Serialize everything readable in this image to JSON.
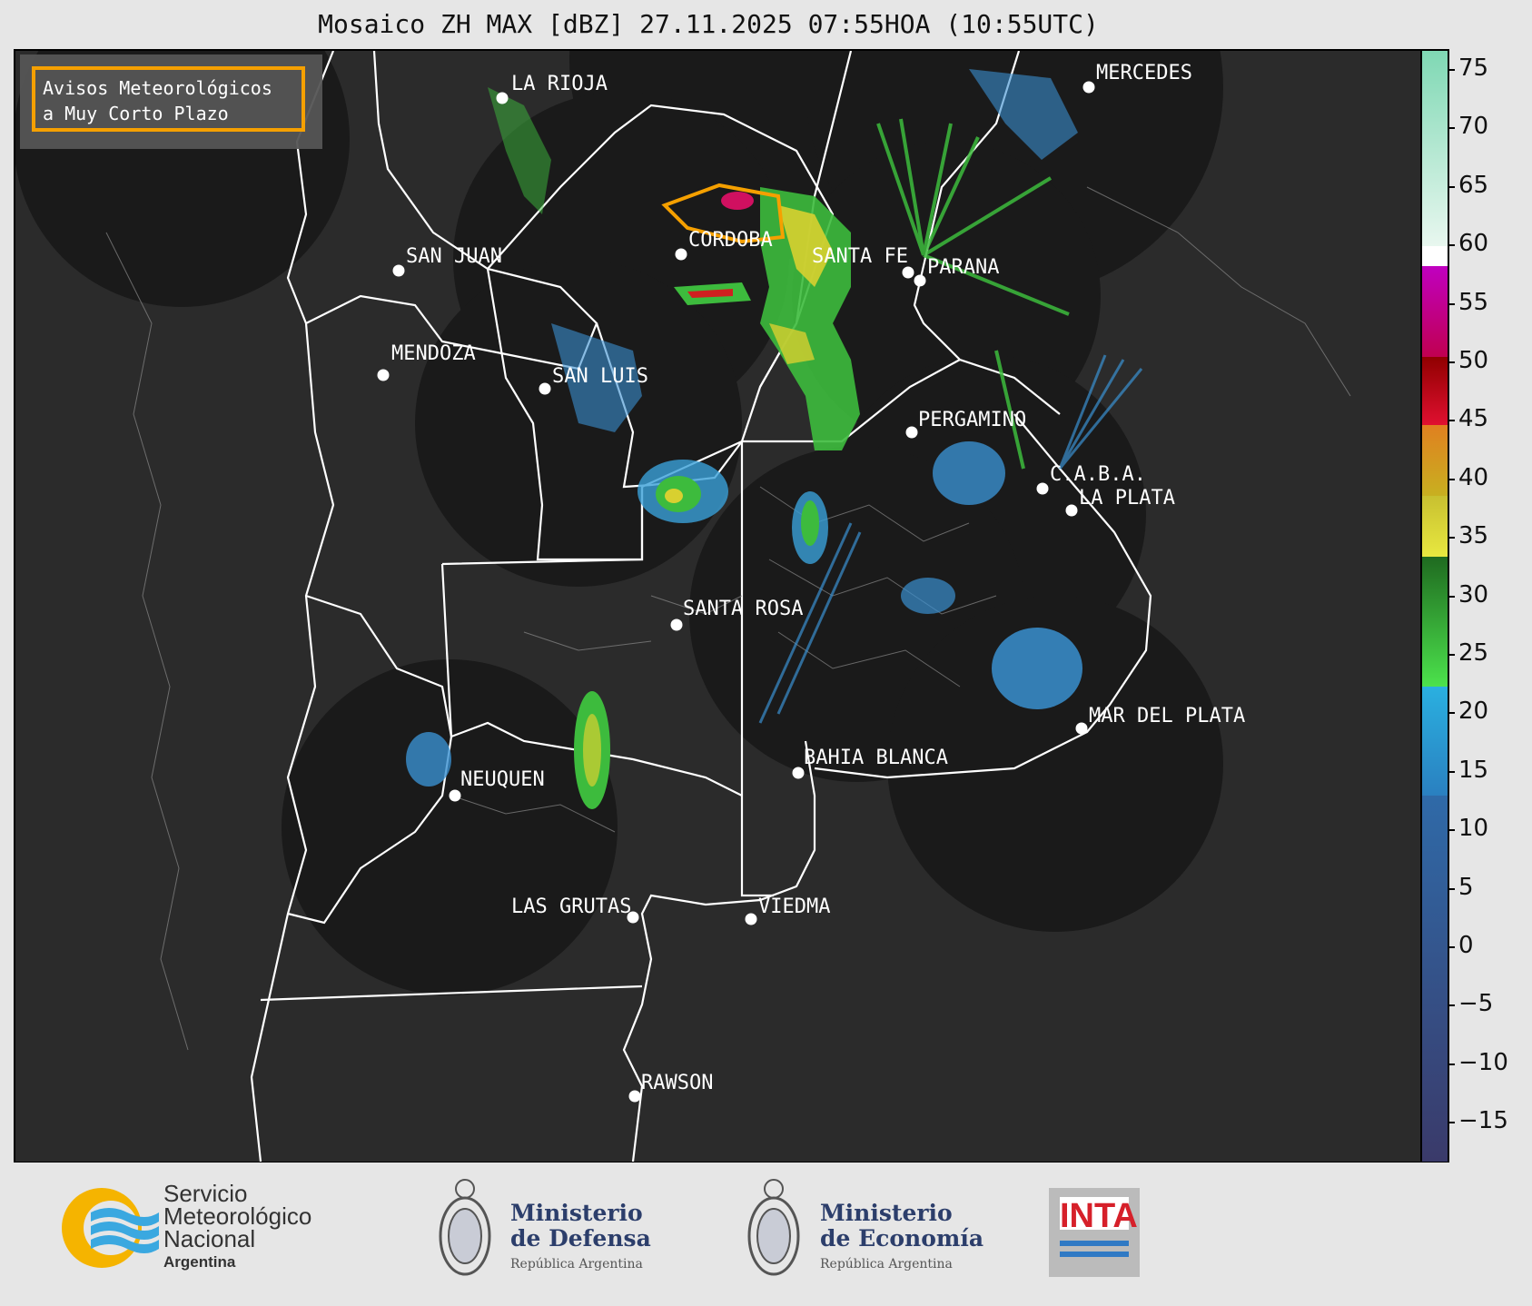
{
  "title": "Mosaico ZH MAX [dBZ] 27.11.2025 07:55HOA (10:55UTC)",
  "legend_box": {
    "text": "Avisos Meteorológicos\na Muy Corto Plazo",
    "color": "#f5a000"
  },
  "cities": [
    {
      "name": "LA RIOJA"
    },
    {
      "name": "MERCEDES"
    },
    {
      "name": "SAN JUAN"
    },
    {
      "name": "CORDOBA"
    },
    {
      "name": "SANTA FE"
    },
    {
      "name": "PARANA"
    },
    {
      "name": "MENDOZA"
    },
    {
      "name": "SAN LUIS"
    },
    {
      "name": "PERGAMINO"
    },
    {
      "name": "C.A.B.A."
    },
    {
      "name": "LA PLATA"
    },
    {
      "name": "SANTA ROSA"
    },
    {
      "name": "MAR DEL PLATA"
    },
    {
      "name": "BAHIA BLANCA"
    },
    {
      "name": "NEUQUEN"
    },
    {
      "name": "LAS GRUTAS"
    },
    {
      "name": "VIEDMA"
    },
    {
      "name": "RAWSON"
    }
  ],
  "colorbar": {
    "unit": "dBZ",
    "ticks": [
      "75",
      "70",
      "65",
      "60",
      "55",
      "50",
      "45",
      "40",
      "35",
      "30",
      "25",
      "20",
      "15",
      "10",
      "5",
      "0",
      "−5",
      "−10",
      "−15"
    ]
  },
  "footer": {
    "smn": {
      "line1": "Servicio",
      "line2": "Meteorológico",
      "line3": "Nacional",
      "line4": "Argentina"
    },
    "defensa": {
      "line1": "Ministerio",
      "line2": "de Defensa",
      "line3": "República Argentina"
    },
    "economia": {
      "line1": "Ministerio",
      "line2": "de Economía",
      "line3": "República Argentina"
    },
    "inta": {
      "text": "INTA"
    }
  },
  "colors": {
    "radar_disk": "#1a1a1a",
    "background": "#2b2b2b",
    "borders": "#ffffff",
    "warning": "#f5a000"
  }
}
